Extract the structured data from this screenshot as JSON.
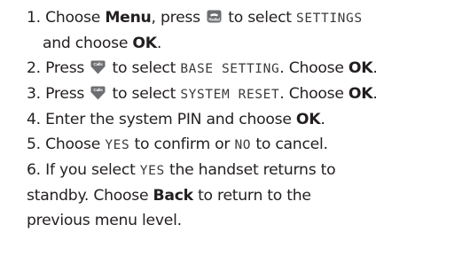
{
  "steps": [
    {
      "num": "1.",
      "choose": "Choose",
      "menu": "Menu",
      "press": ", press",
      "icon": "redial-key-icon",
      "to_select": "to select",
      "settings": "SETTINGS",
      "and_choose": "and choose",
      "ok": "OK",
      "end": "."
    },
    {
      "num": "2.",
      "press": "Press",
      "icon": "calls-key-icon",
      "to_select": "to select",
      "item": "BASE SETTING",
      "choose": ". Choose",
      "ok": "OK",
      "end": "."
    },
    {
      "num": "3.",
      "press": "Press",
      "icon": "calls-key-icon",
      "to_select": "to select",
      "item": "SYSTEM RESET",
      "choose": ". Choose",
      "ok": "OK",
      "end": "."
    },
    {
      "num": "4.",
      "text": "Enter the system PIN and choose",
      "ok": "OK",
      "end": "."
    },
    {
      "num": "5.",
      "choose": "Choose",
      "yes": "YES",
      "mid": "to confirm or",
      "no": "NO",
      "end": "to cancel."
    },
    {
      "num": "6.",
      "if": "If you select",
      "yes": "YES",
      "rest": "the handset returns to",
      "line2_pre": "standby.  Choose",
      "back": "Back",
      "line2_post": "to return to the",
      "line3": "previous menu level."
    }
  ],
  "icons": {
    "redial_label": "Redial",
    "calls_label": "Calls"
  },
  "colors": {
    "text": "#231f20",
    "key_fill": "#6d6e71",
    "key_text": "#ffffff"
  }
}
